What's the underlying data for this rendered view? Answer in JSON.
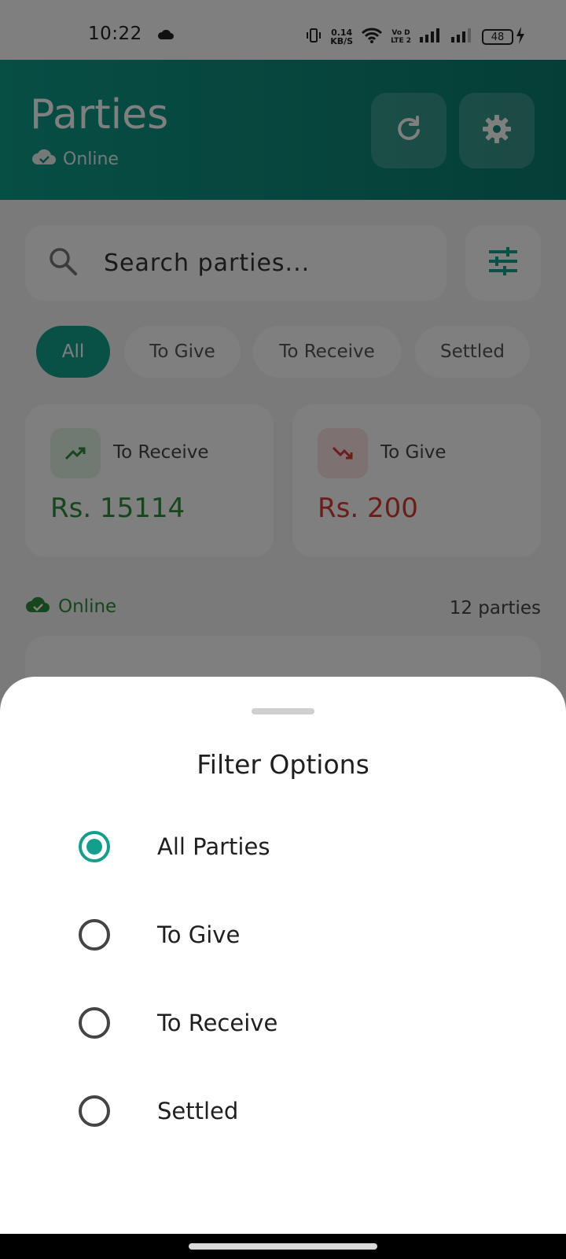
{
  "status_bar": {
    "time": "10:22",
    "speed_value": "0.14",
    "speed_unit": "KB/S",
    "volte_top": "Vo D",
    "volte_bottom": "LTE 2",
    "battery": "48"
  },
  "header": {
    "title": "Parties",
    "status": "Online",
    "refresh_icon": "refresh-icon",
    "settings_icon": "gear-icon"
  },
  "search": {
    "placeholder": "Search parties..."
  },
  "chips": [
    {
      "label": "All",
      "active": true
    },
    {
      "label": "To Give",
      "active": false
    },
    {
      "label": "To Receive",
      "active": false
    },
    {
      "label": "Settled",
      "active": false
    }
  ],
  "summary": {
    "receive": {
      "label": "To Receive",
      "amount": "Rs.  15114"
    },
    "give": {
      "label": "To Give",
      "amount": "Rs.  200"
    }
  },
  "list": {
    "status": "Online",
    "count": "12 parties"
  },
  "filter_sheet": {
    "title": "Filter Options",
    "options": [
      {
        "label": "All Parties",
        "selected": true
      },
      {
        "label": "To Give",
        "selected": false
      },
      {
        "label": "To Receive",
        "selected": false
      },
      {
        "label": "Settled",
        "selected": false
      }
    ]
  },
  "colors": {
    "accent": "#12a08d",
    "positive": "#2e8b3a",
    "negative": "#d43a32"
  }
}
